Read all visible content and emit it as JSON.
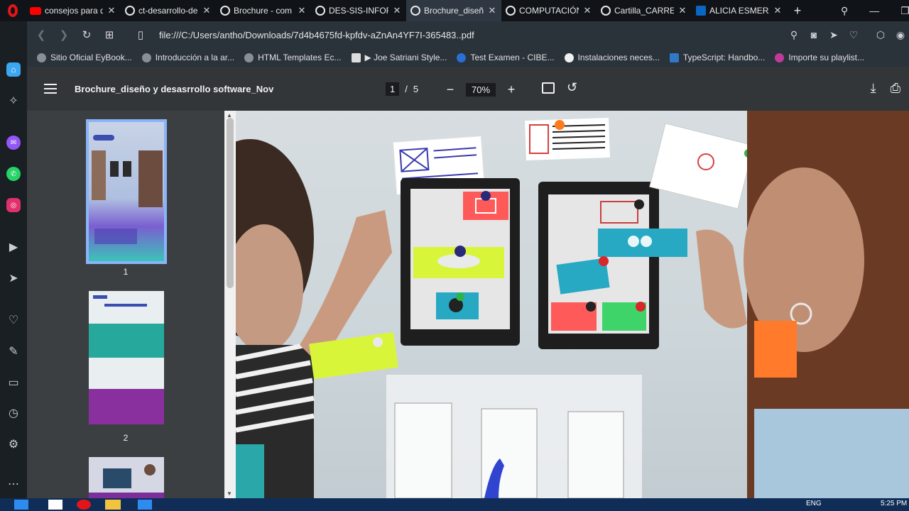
{
  "tabs": [
    {
      "label": "consejos para q",
      "favicon": "youtube-icon",
      "active": false
    },
    {
      "label": "ct-desarrollo-de",
      "favicon": "globe-icon",
      "active": false
    },
    {
      "label": "Brochure - com",
      "favicon": "globe-icon",
      "active": false
    },
    {
      "label": "DES-SIS-INFOR",
      "favicon": "globe-icon",
      "active": false
    },
    {
      "label": "Brochure_diseñ",
      "favicon": "globe-icon",
      "active": true
    },
    {
      "label": "COMPUTACIÓN",
      "favicon": "globe-icon",
      "active": false
    },
    {
      "label": "Cartilla_CARRER",
      "favicon": "globe-icon",
      "active": false
    },
    {
      "label": "ALICIA ESMERA",
      "favicon": "linkedin-icon",
      "active": false
    }
  ],
  "address": {
    "url": "file:///C:/Users/antho/Downloads/7d4b4675fd-kpfdv-aZnAn4YF7I-365483..pdf"
  },
  "bookmarks": [
    "Sitio Oficial EyBook...",
    "Introducción a la ar...",
    "HTML Templates Ec...",
    "▶ Joe Satriani Style...",
    "Test Examen - CIBE...",
    "Instalaciones neces...",
    "TypeScript: Handbo...",
    "Importe su playlist..."
  ],
  "pdf": {
    "title": "Brochure_diseño y desasrrollo software_Nov",
    "current_page": "1",
    "page_separator": "/",
    "total_pages": "5",
    "zoom": "70%",
    "zoom_out": "−",
    "zoom_in": "+"
  },
  "thumbnails": [
    {
      "label": "1",
      "selected": true
    },
    {
      "label": "2",
      "selected": false
    }
  ],
  "taskbar": {
    "language": "ENG",
    "time": "5:25 PM"
  },
  "colors": {
    "accent": "#8ab4f8",
    "opera_red": "#e3151a",
    "toolbar": "#323639"
  }
}
